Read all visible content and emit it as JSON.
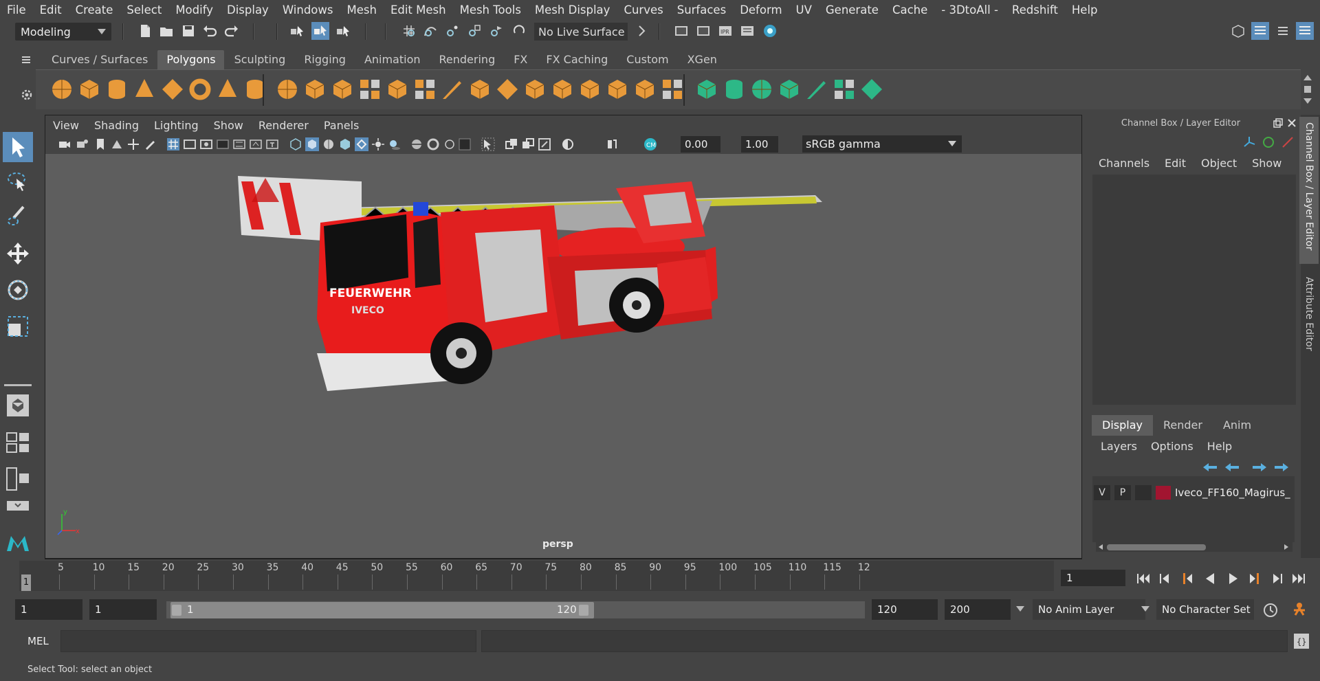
{
  "menubar": [
    "File",
    "Edit",
    "Create",
    "Select",
    "Modify",
    "Display",
    "Windows",
    "Mesh",
    "Edit Mesh",
    "Mesh Tools",
    "Mesh Display",
    "Curves",
    "Surfaces",
    "Deform",
    "UV",
    "Generate",
    "Cache",
    "- 3DtoAll -",
    "Redshift",
    "Help"
  ],
  "statusline": {
    "mode": "Modeling",
    "live_surface": "No Live Surface"
  },
  "shelf": {
    "tabs": [
      "Curves / Surfaces",
      "Polygons",
      "Sculpting",
      "Rigging",
      "Animation",
      "Rendering",
      "FX",
      "FX Caching",
      "Custom",
      "XGen"
    ],
    "active_tab": "Polygons"
  },
  "viewport": {
    "menu": [
      "View",
      "Shading",
      "Lighting",
      "Show",
      "Renderer",
      "Panels"
    ],
    "exposure": "0.00",
    "gamma_value": "1.00",
    "color_space": "sRGB gamma",
    "camera_label": "persp",
    "axis_y": "y",
    "axis_x": "x"
  },
  "right_panel": {
    "title": "Channel Box / Layer Editor",
    "cb_menu": [
      "Channels",
      "Edit",
      "Object",
      "Show"
    ],
    "layer_tabs": [
      "Display",
      "Render",
      "Anim"
    ],
    "layer_menu": [
      "Layers",
      "Options",
      "Help"
    ],
    "layer": {
      "v": "V",
      "p": "P",
      "name": "Iveco_FF160_Magirus_",
      "color": "#a11530"
    },
    "side_tab_1": "Channel Box / Layer Editor",
    "side_tab_2": "Attribute Editor"
  },
  "timeline": {
    "ticks": [
      "5",
      "10",
      "15",
      "20",
      "25",
      "30",
      "35",
      "40",
      "45",
      "50",
      "55",
      "60",
      "65",
      "70",
      "75",
      "80",
      "85",
      "90",
      "95",
      "100",
      "105",
      "110",
      "115",
      "12"
    ],
    "current_frame_marker": "1",
    "current_frame": "1"
  },
  "range": {
    "start": "1",
    "playback_start": "1",
    "bar_start": "1",
    "bar_end": "120",
    "playback_end": "120",
    "end": "200",
    "anim_layer": "No Anim Layer",
    "character_set": "No Character Set"
  },
  "command": {
    "label": "MEL"
  },
  "help_line": "Select Tool: select an object",
  "truck_text": {
    "side": "FEUERWEHR",
    "grill": "IVECO"
  }
}
